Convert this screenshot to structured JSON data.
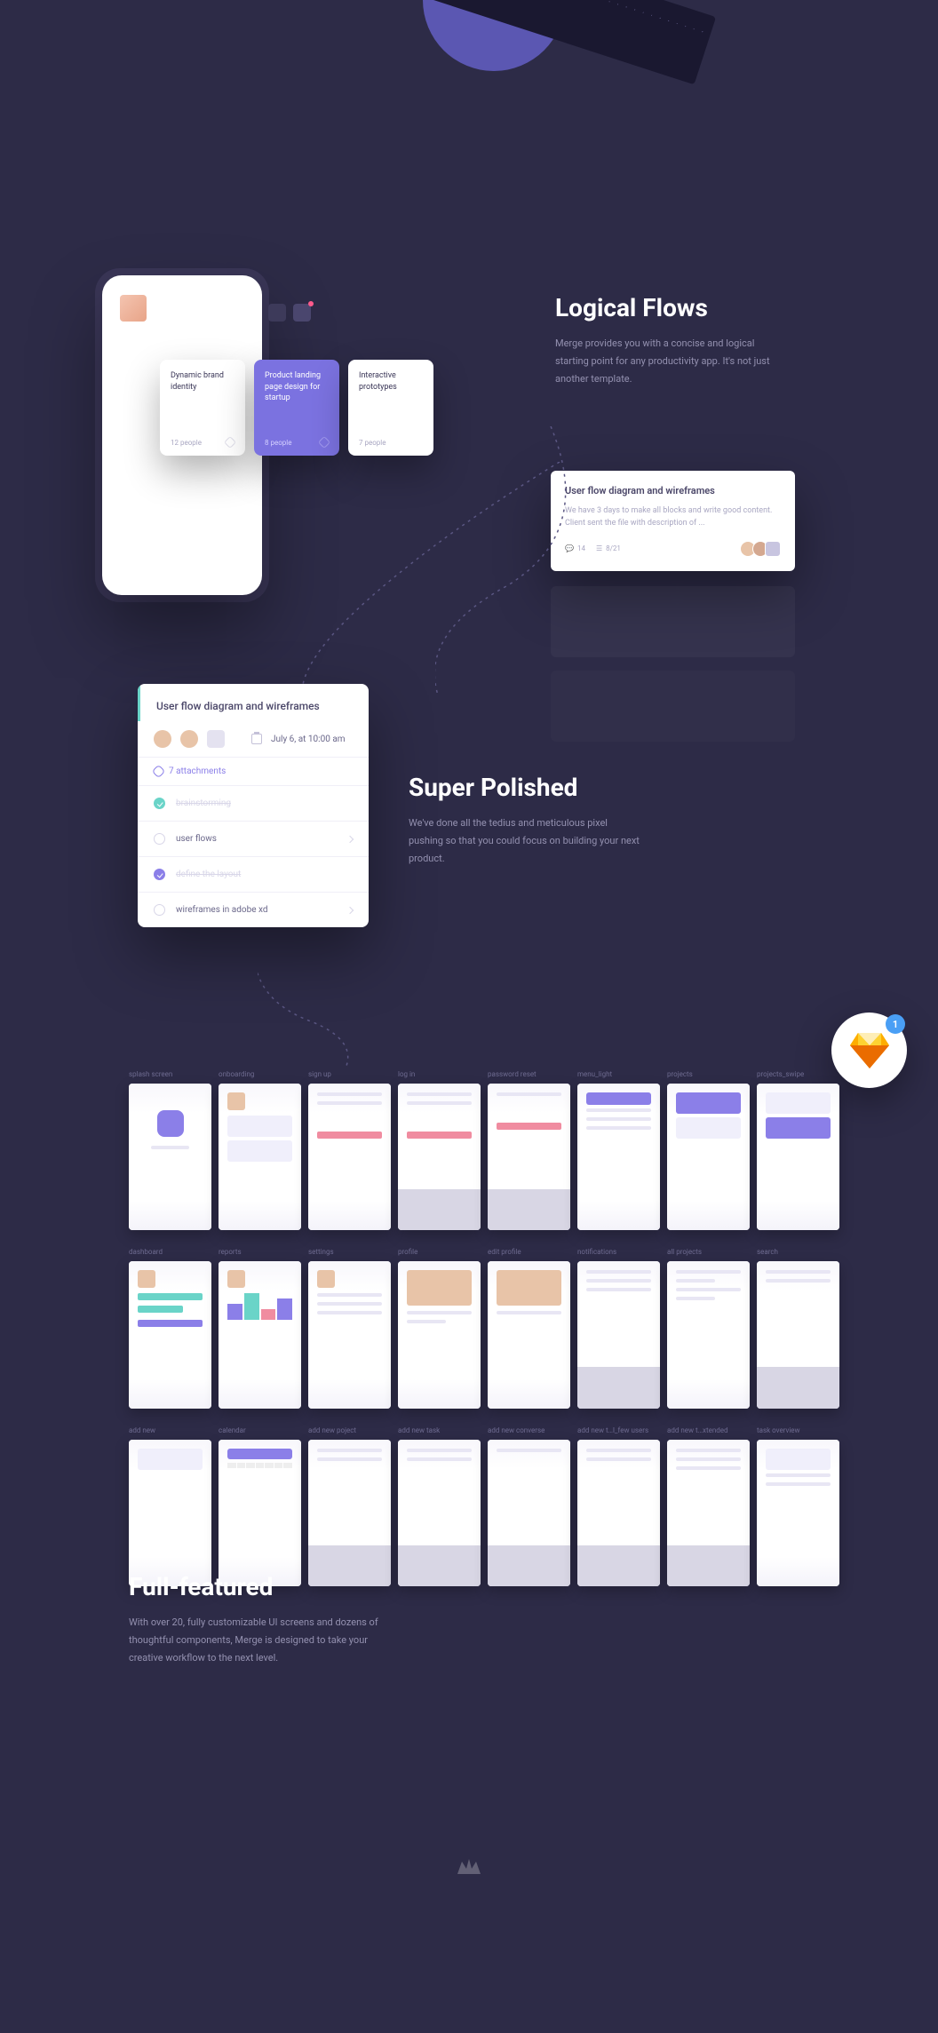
{
  "logical": {
    "heading": "Logical Flows",
    "body": "Merge provides you with a concise and logical starting point for any productivity app. It's not just another template."
  },
  "cards": [
    {
      "title": "Dynamic brand identity",
      "people": "12 people"
    },
    {
      "title": "Product landing page design for startup",
      "people": "8 people"
    },
    {
      "title": "Interactive prototypes",
      "people": "7 people"
    }
  ],
  "task": {
    "title": "User flow diagram and wireframes",
    "desc": "We have 3 days to make all blocks and write good content. Client sent the file with description of ...",
    "comments": "14",
    "progress": "8/21"
  },
  "detail": {
    "title": "User flow diagram and wireframes",
    "date": "July 6, at 10:00 am",
    "attachments": "7 attachments",
    "items": [
      {
        "label": "brainstorming",
        "done": true
      },
      {
        "label": "user flows",
        "done": false
      },
      {
        "label": "define the layout",
        "done": true,
        "purple": true
      },
      {
        "label": "wireframes in adobe xd",
        "done": false
      }
    ]
  },
  "polished": {
    "heading": "Super Polished",
    "body": "We've done all the tedius and meticulous pixel pushing so that you could focus on building your next product."
  },
  "screens": {
    "row1": [
      "splash screen",
      "onboarding",
      "sign up",
      "log in",
      "password reset",
      "menu_light",
      "projects",
      "projects_swipe"
    ],
    "row2": [
      "dashboard",
      "reports",
      "settings",
      "profile",
      "edit profile",
      "notifications",
      "all projects",
      "search"
    ],
    "row3": [
      "add new",
      "calendar",
      "add new poject",
      "add new task",
      "add new converse",
      "add new t…l_few users",
      "add new t…xtended",
      "task overview"
    ]
  },
  "full": {
    "heading": "Full-featured",
    "body": "With over 20, fully customizable UI screens and dozens of thoughtful components, Merge is designed to take your creative workflow to the next level."
  },
  "sketch_badge": "1"
}
